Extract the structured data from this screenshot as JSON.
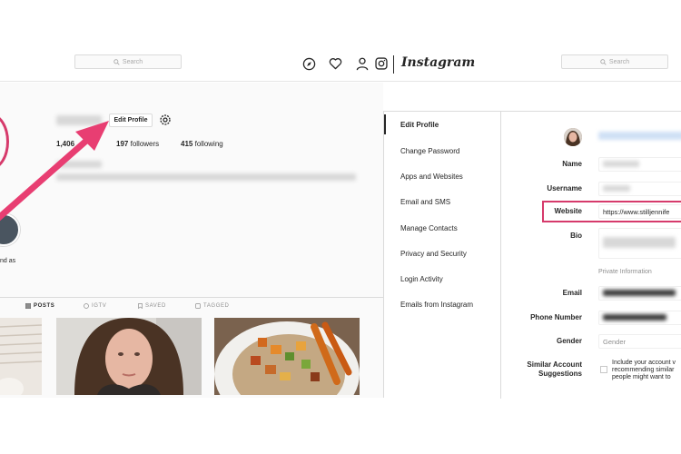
{
  "header": {
    "search_placeholder": "Search",
    "logo": "Instagram",
    "icons": [
      "compass-icon",
      "heart-icon",
      "person-icon",
      "instagram-glyph-icon"
    ]
  },
  "profile": {
    "edit_button": "Edit Profile",
    "posts_count": "1,406",
    "followers_count": "197",
    "followers_label": "followers",
    "following_count": "415",
    "following_label": "following",
    "story_label": "nd as",
    "tabs": [
      {
        "label": "POSTS",
        "icon": "grid-icon",
        "active": true
      },
      {
        "label": "IGTV",
        "icon": "tv-icon",
        "active": false
      },
      {
        "label": "SAVED",
        "icon": "bookmark-icon",
        "active": false
      },
      {
        "label": "TAGGED",
        "icon": "tag-icon",
        "active": false
      }
    ]
  },
  "settings_menu": {
    "items": [
      "Edit Profile",
      "Change Password",
      "Apps and Websites",
      "Email and SMS",
      "Manage Contacts",
      "Privacy and Security",
      "Login Activity",
      "Emails from Instagram"
    ],
    "active_index": 0
  },
  "form": {
    "name_label": "Name",
    "username_label": "Username",
    "website_label": "Website",
    "website_value": "https://www.stilljennife",
    "bio_label": "Bio",
    "private_info": "Private Information",
    "email_label": "Email",
    "phone_label": "Phone Number",
    "gender_label": "Gender",
    "gender_placeholder": "Gender",
    "suggestions_label_1": "Similar Account",
    "suggestions_label_2": "Suggestions",
    "suggestions_text": "Include your account v recommending similar people might want to"
  },
  "colors": {
    "accent_pink": "#e83e72",
    "border": "#dbdbdb"
  }
}
